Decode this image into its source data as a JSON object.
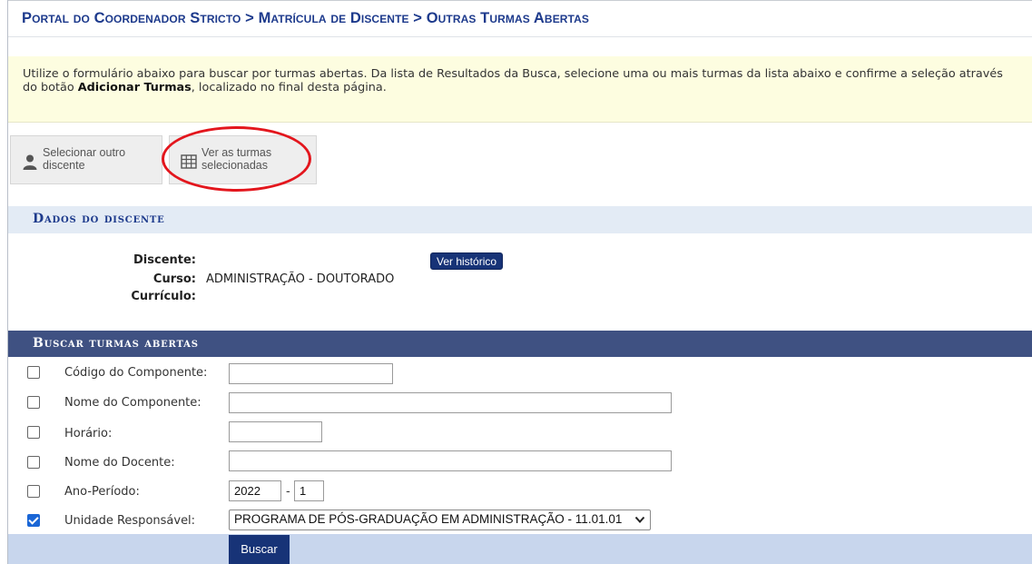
{
  "breadcrumb": "Portal do Coordenador Stricto > Matrícula de Discente > Outras Turmas Abertas",
  "notice": {
    "text_before": "Utilize o formulário abaixo para buscar por turmas abertas. Da lista de Resultados da Busca, selecione uma ou mais turmas da lista abaixo e confirme a seleção através do botão ",
    "bold": "Adicionar Turmas",
    "text_after": ", localizado no final desta página."
  },
  "toolbar": {
    "select_other_label": "Selecionar outro discente",
    "view_selected_label": "Ver as turmas selecionadas"
  },
  "dados": {
    "title": "Dados do discente",
    "discente_label": "Discente:",
    "curso_label": "Curso:",
    "curso_value": "ADMINISTRAÇÃO - DOUTORADO",
    "curriculo_label": "Currículo:",
    "ver_historico": "Ver histórico"
  },
  "buscar": {
    "title": "Buscar turmas abertas",
    "fields": {
      "codigo": {
        "label": "Código do Componente:",
        "value": ""
      },
      "nome_componente": {
        "label": "Nome do Componente:",
        "value": ""
      },
      "horario": {
        "label": "Horário:",
        "value": ""
      },
      "nome_docente": {
        "label": "Nome do Docente:",
        "value": ""
      },
      "ano_periodo": {
        "label": "Ano-Período:",
        "ano": "2022",
        "separator": "-",
        "periodo": "1"
      },
      "unidade": {
        "label": "Unidade Responsável:",
        "selected": "PROGRAMA DE PÓS-GRADUAÇÃO EM ADMINISTRAÇÃO - 11.01.01",
        "checked": true
      }
    },
    "submit_label": "Buscar"
  },
  "icons": [
    "user-icon",
    "table-grid-icon",
    "chevron-down-icon"
  ],
  "colors": {
    "brand_navy": "#173377",
    "header_blue": "#3f5182",
    "breadcrumb_text": "#1d3a8c",
    "highlight_red": "#e3161d",
    "notice_bg": "#fdfde0"
  }
}
